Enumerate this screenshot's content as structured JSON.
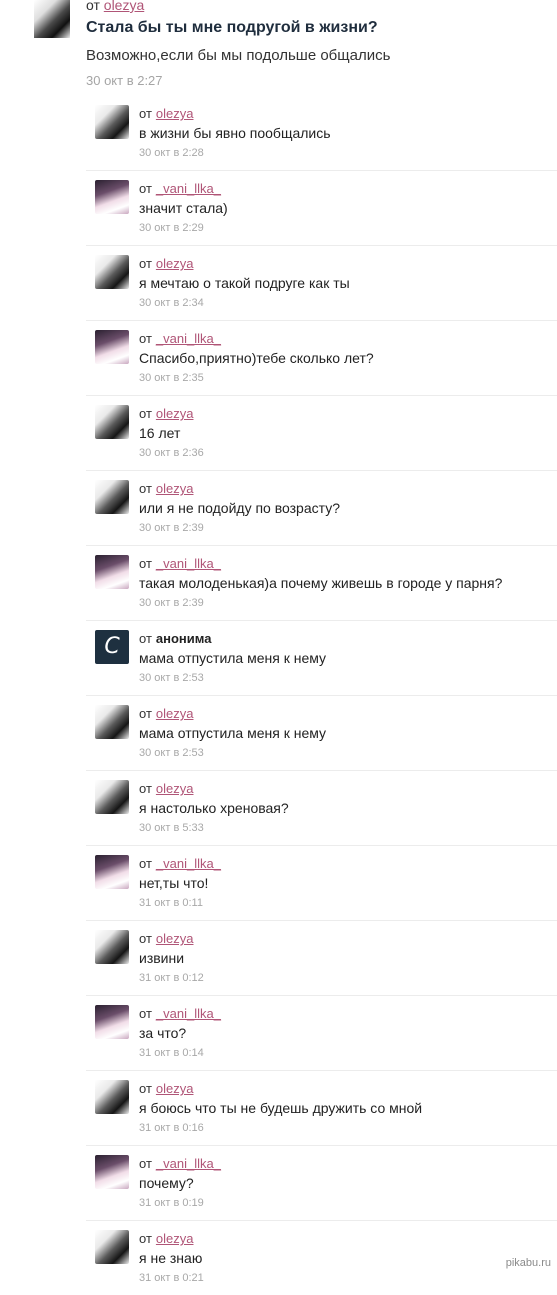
{
  "question": {
    "from_prefix": "от",
    "author": "olezya",
    "text": "Стала бы ты мне подругой в жизни?",
    "answer": "Возможно,если бы мы подольше общались",
    "time": "30 окт в 2:27"
  },
  "comments": [
    {
      "author": "olezya",
      "avatar": "olezya",
      "text": "в жизни бы явно пообщались",
      "time": "30 окт в 2:28"
    },
    {
      "author": "_vani_llka_",
      "avatar": "vani",
      "text": "значит стала)",
      "time": "30 окт в 2:29"
    },
    {
      "author": "olezya",
      "avatar": "olezya",
      "text": "я мечтаю о такой подруге как ты",
      "time": "30 окт в 2:34"
    },
    {
      "author": "_vani_llka_",
      "avatar": "vani",
      "text": "Спасибо,приятно)тебе сколько лет?",
      "time": "30 окт в 2:35"
    },
    {
      "author": "olezya",
      "avatar": "olezya",
      "text": "16 лет",
      "time": "30 окт в 2:36"
    },
    {
      "author": "olezya",
      "avatar": "olezya",
      "text": "или я не подойду по возрасту?",
      "time": "30 окт в 2:39"
    },
    {
      "author": "_vani_llka_",
      "avatar": "vani",
      "text": "такая молоденькая)а почему живешь в городе у парня?",
      "time": "30 окт в 2:39"
    },
    {
      "author": "анонима",
      "avatar": "anon",
      "text": "мама отпустила меня к нему",
      "time": "30 окт в 2:53"
    },
    {
      "author": "olezya",
      "avatar": "olezya",
      "text": "мама отпустила меня к нему",
      "time": "30 окт в 2:53"
    },
    {
      "author": "olezya",
      "avatar": "olezya",
      "text": "я настолько хреновая?",
      "time": "30 окт в 5:33"
    },
    {
      "author": "_vani_llka_",
      "avatar": "vani",
      "text": "нет,ты что!",
      "time": "31 окт в 0:11"
    },
    {
      "author": "olezya",
      "avatar": "olezya",
      "text": "извини",
      "time": "31 окт в 0:12"
    },
    {
      "author": "_vani_llka_",
      "avatar": "vani",
      "text": "за что?",
      "time": "31 окт в 0:14"
    },
    {
      "author": "olezya",
      "avatar": "olezya",
      "text": "я боюсь что ты не будешь дружить со мной",
      "time": "31 окт в 0:16"
    },
    {
      "author": "_vani_llka_",
      "avatar": "vani",
      "text": "почему?",
      "time": "31 окт в 0:19"
    },
    {
      "author": "olezya",
      "avatar": "olezya",
      "text": "я не знаю",
      "time": "31 окт в 0:21"
    }
  ],
  "watermark": "pikabu.ru"
}
